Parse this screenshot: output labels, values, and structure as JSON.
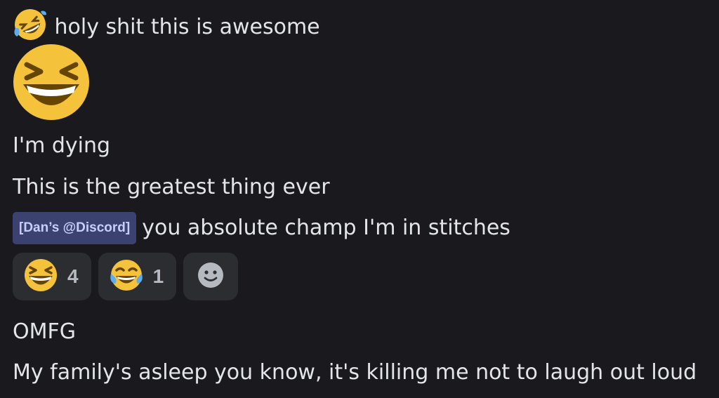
{
  "messages": {
    "line1": "holy shit this is awesome",
    "line3": "I'm dying",
    "line4": "This is the greatest thing ever",
    "mention": "[Dan’s @Discord]",
    "line5": "you absolute champ I'm in stitches",
    "line6": "OMFG",
    "line7": "My family's asleep you know, it's killing me not to laugh out loud"
  },
  "reactions": [
    {
      "icon": "laughing-face-icon",
      "count": "4"
    },
    {
      "icon": "tears-of-joy-icon",
      "count": "1"
    },
    {
      "icon": "add-reaction-icon"
    }
  ],
  "colors": {
    "background": "#1a1a1e",
    "text": "#e3e5e8",
    "mention_bg": "#3c4270",
    "mention_text": "#c9cdfb",
    "reaction_bg": "#2b2d31",
    "emoji_yellow": "#f5c33b"
  }
}
